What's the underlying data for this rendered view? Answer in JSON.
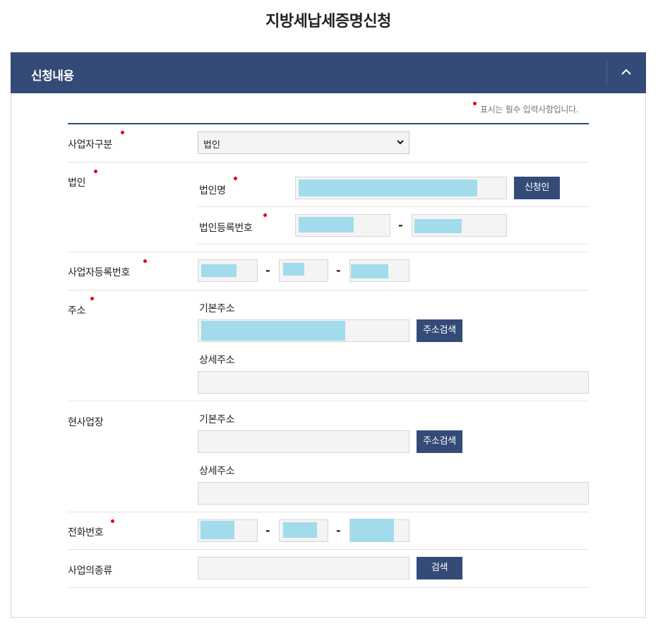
{
  "page": {
    "title": "지방세납세증명신청"
  },
  "section": {
    "title": "신청내용",
    "required_note": "표시는 필수 입력사항입니다."
  },
  "form": {
    "business_type": {
      "label": "사업자구분",
      "selected": "법인"
    },
    "corporation": {
      "label": "법인",
      "name_label": "법인명",
      "applicant_button": "신청인",
      "reg_no_label": "법인등록번호",
      "dash": "-"
    },
    "business_reg_no": {
      "label": "사업자등록번호",
      "dash": "-"
    },
    "address": {
      "label": "주소",
      "basic_label": "기본주소",
      "search_button": "주소검색",
      "detail_label": "상세주소"
    },
    "workplace": {
      "label": "현사업장",
      "basic_label": "기본주소",
      "search_button": "주소검색",
      "detail_label": "상세주소"
    },
    "phone": {
      "label": "전화번호",
      "dash": "-"
    },
    "business_kind": {
      "label": "사업의종류",
      "search_button": "검색"
    }
  },
  "colors": {
    "header_bg": "#344b78",
    "required_dot": "#e60012",
    "field_bg": "#f4f4f4",
    "redaction": "#a2dbeb"
  },
  "icons": {
    "collapse": "chevron-up-icon",
    "select_arrow": "chevron-down-icon"
  }
}
